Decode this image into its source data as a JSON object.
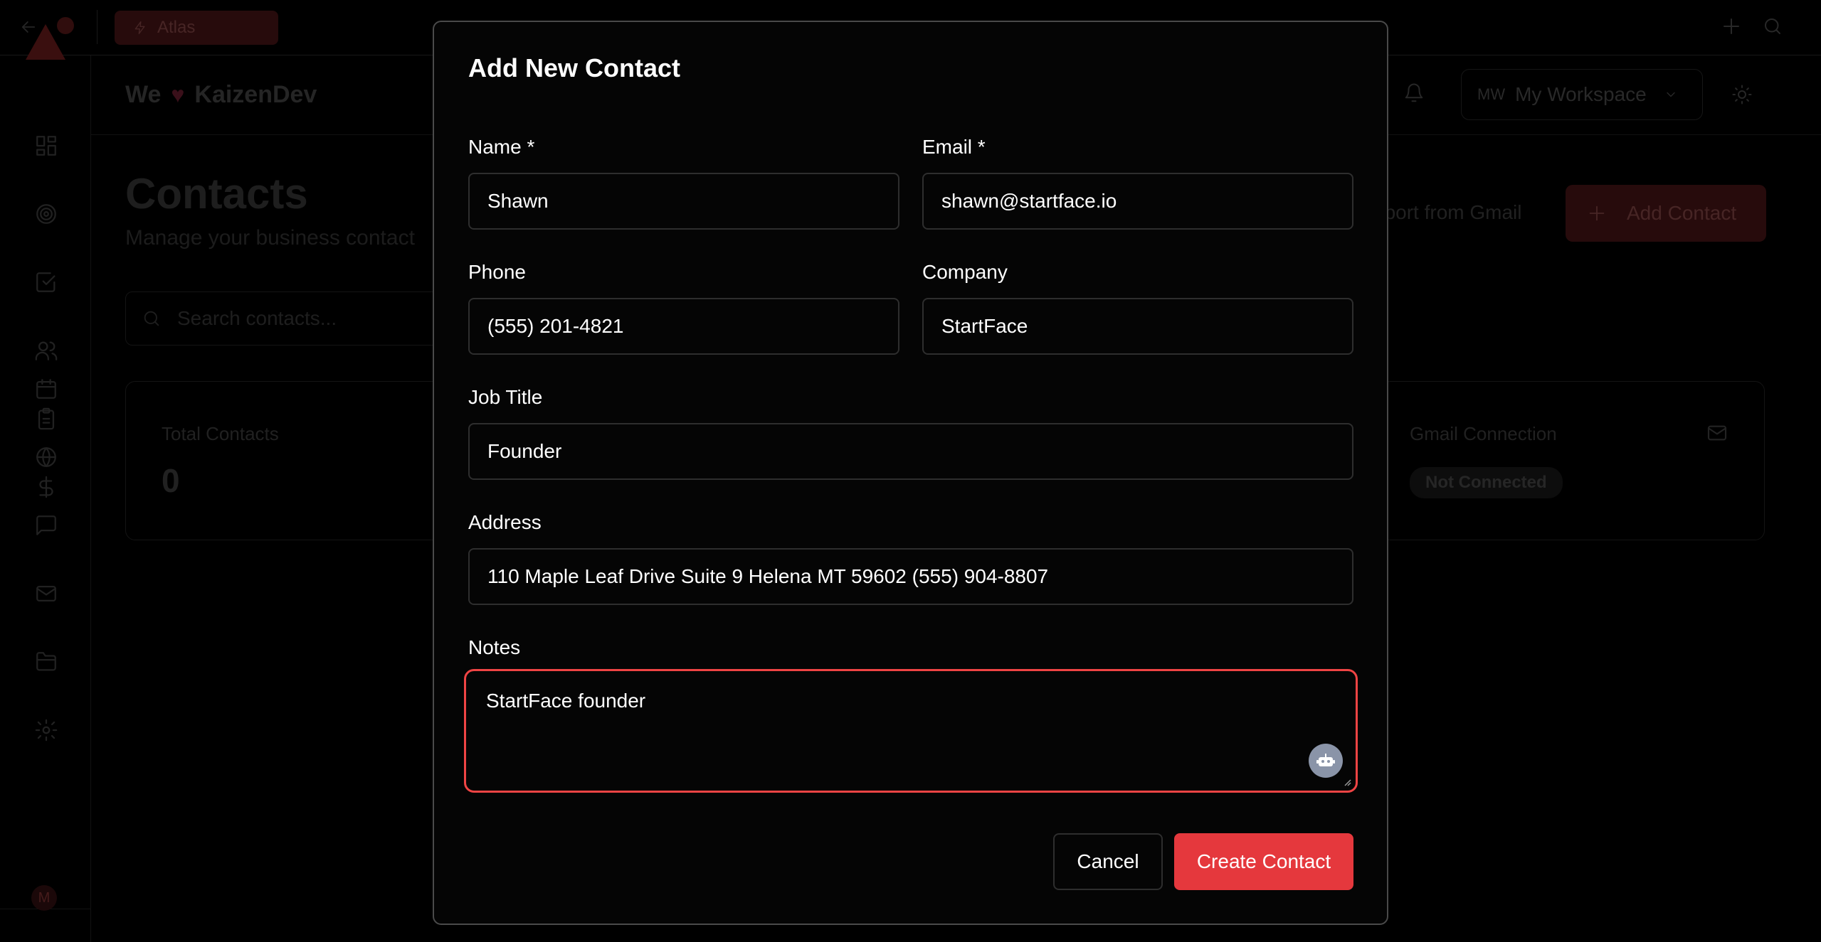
{
  "topbar": {
    "atlas_label": "Atlas"
  },
  "header": {
    "brand_prefix": "We",
    "brand_name": "KaizenDev",
    "workspace_initials": "MW",
    "workspace_name": "My Workspace"
  },
  "sidebar": {
    "user_initial": "M"
  },
  "page": {
    "title": "Contacts",
    "subtitle": "Manage your business contact",
    "import_label": "nport from Gmail",
    "add_contact_label": "Add Contact",
    "search_placeholder": "Search contacts...",
    "stats": {
      "total_label": "Total Contacts",
      "total_value": "0",
      "gmail_label": "Gmail Connection",
      "gmail_status": "Not Connected"
    }
  },
  "modal": {
    "title": "Add New Contact",
    "fields": {
      "name": {
        "label": "Name *",
        "value": "Shawn"
      },
      "email": {
        "label": "Email *",
        "value": "shawn@startface.io"
      },
      "phone": {
        "label": "Phone",
        "value": "(555) 201-4821"
      },
      "company": {
        "label": "Company",
        "value": "StartFace"
      },
      "job_title": {
        "label": "Job Title",
        "value": "Founder"
      },
      "address": {
        "label": "Address",
        "value": "110 Maple Leaf Drive Suite 9 Helena MT 59602 (555) 904-8807"
      },
      "notes": {
        "label": "Notes",
        "value": "StartFace founder"
      }
    },
    "cancel_label": "Cancel",
    "create_label": "Create Contact"
  },
  "colors": {
    "accent": "#e5383d",
    "focus_ring": "#ef4444",
    "background": "#000000"
  }
}
